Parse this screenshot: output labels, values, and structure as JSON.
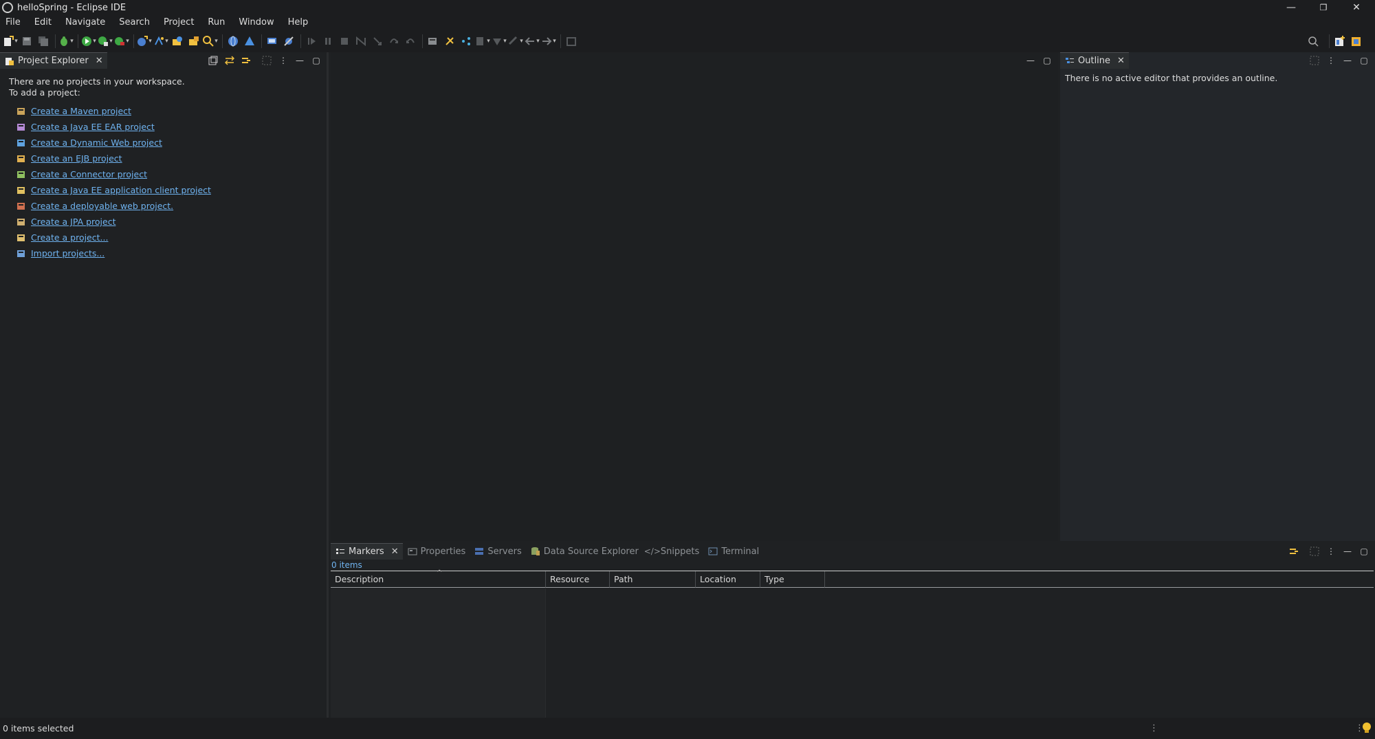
{
  "window": {
    "title": "helloSpring - Eclipse IDE",
    "controls": [
      "—",
      "❐",
      "✕"
    ]
  },
  "menu": [
    "File",
    "Edit",
    "Navigate",
    "Search",
    "Project",
    "Run",
    "Window",
    "Help"
  ],
  "project_explorer": {
    "tab_label": "Project Explorer",
    "message_line1": "There are no projects in your workspace.",
    "message_line2": "To add a project:",
    "links": [
      {
        "label": "Create a Maven project",
        "icon": "maven-project-icon",
        "color": "#c9a35a"
      },
      {
        "label": "Create a Java EE EAR project",
        "icon": "ear-project-icon",
        "color": "#b58ad6"
      },
      {
        "label": "Create a Dynamic Web project",
        "icon": "web-project-icon",
        "color": "#5fa3e0"
      },
      {
        "label": "Create an EJB project",
        "icon": "ejb-project-icon",
        "color": "#e0b050"
      },
      {
        "label": "Create a Connector project",
        "icon": "connector-project-icon",
        "color": "#8fc060"
      },
      {
        "label": "Create a Java EE application client project",
        "icon": "client-project-icon",
        "color": "#e0c060"
      },
      {
        "label": "Create a deployable web project.",
        "icon": "deployable-web-icon",
        "color": "#d07050"
      },
      {
        "label": "Create a JPA project",
        "icon": "jpa-project-icon",
        "color": "#d0b070"
      },
      {
        "label": "Create a project...",
        "icon": "new-project-icon",
        "color": "#e0c070"
      },
      {
        "label": "Import projects...",
        "icon": "import-icon",
        "color": "#6fa0d8"
      }
    ]
  },
  "outline": {
    "tab_label": "Outline",
    "message": "There is no active editor that provides an outline."
  },
  "bottom": {
    "tabs": [
      {
        "label": "Markers",
        "active": true
      },
      {
        "label": "Properties",
        "active": false
      },
      {
        "label": "Servers",
        "active": false
      },
      {
        "label": "Data Source Explorer",
        "active": false
      },
      {
        "label": "Snippets",
        "active": false
      },
      {
        "label": "Terminal",
        "active": false
      }
    ],
    "count": "0 items",
    "columns": [
      "Description",
      "Resource",
      "Path",
      "Location",
      "Type"
    ],
    "sort_indicator": "^"
  },
  "status": {
    "text": "0 items selected"
  },
  "colors": {
    "link": "#6fb3f0",
    "background": "#1f2123",
    "chrome": "#1c1d1f"
  }
}
